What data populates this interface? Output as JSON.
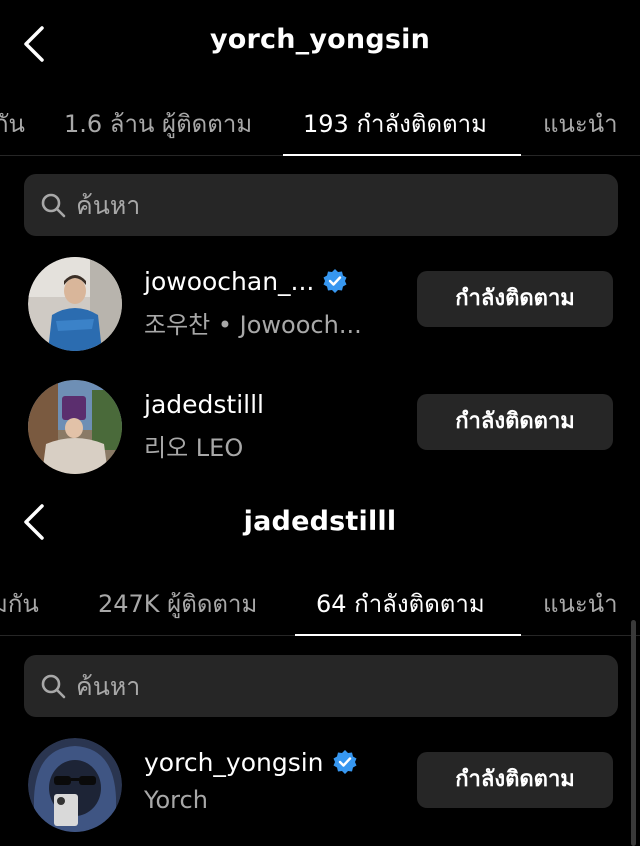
{
  "screen_top": {
    "title": "yorch_yongsin",
    "tabs": [
      {
        "label": "กัน"
      },
      {
        "label": "1.6 ล้าน ผู้ติดตาม"
      },
      {
        "label": "193 กำลังติดตาม"
      },
      {
        "label": "แนะนำ"
      }
    ],
    "search_placeholder": "ค้นหา",
    "rows": [
      {
        "username": "jowoochan_...",
        "verified": true,
        "fullname": "조우찬 • Jowooch...",
        "button": "กำลังติดตาม"
      },
      {
        "username": "jadedstilll",
        "verified": false,
        "fullname": "리오 LEO",
        "button": "กำลังติดตาม"
      }
    ]
  },
  "screen_bottom": {
    "title": "jadedstilll",
    "tabs": [
      {
        "label": "มกัน"
      },
      {
        "label": "247K ผู้ติดตาม"
      },
      {
        "label": "64 กำลังติดตาม"
      },
      {
        "label": "แนะนำ"
      }
    ],
    "search_placeholder": "ค้นหา",
    "rows": [
      {
        "username": "yorch_yongsin",
        "verified": true,
        "fullname": "Yorch",
        "button": "กำลังติดตาม"
      }
    ]
  },
  "colors": {
    "background": "#000000",
    "surface": "#262626",
    "secondary_text": "#a8a8a8",
    "verified_blue": "#3797f0"
  },
  "icons": [
    "back-chevron-icon",
    "search-icon",
    "verified-badge-icon"
  ]
}
